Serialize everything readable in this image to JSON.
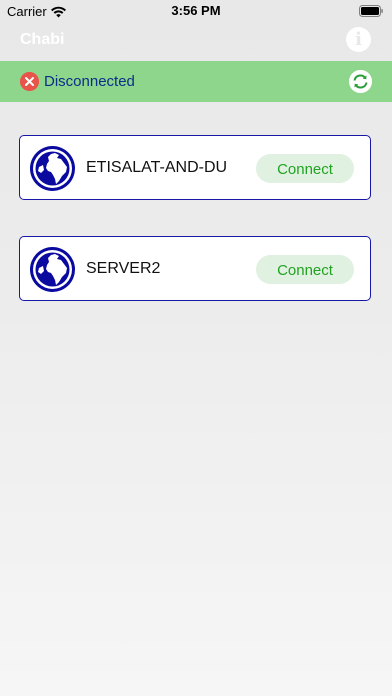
{
  "status_bar": {
    "carrier": "Carrier",
    "time": "3:56 PM"
  },
  "nav": {
    "title": "Chabi",
    "info_glyph": "i"
  },
  "banner": {
    "status_text": "Disconnected",
    "background_color": "#8ed68b",
    "text_color": "#0b2e8a",
    "status_icon": "x-circle-icon",
    "refresh_icon": "refresh-icon"
  },
  "servers": [
    {
      "name": "ETISALAT-AND-DU",
      "button_label": "Connect",
      "icon": "globe-icon"
    },
    {
      "name": "SERVER2",
      "button_label": "Connect",
      "icon": "globe-icon"
    }
  ],
  "colors": {
    "card_border": "#1818a8",
    "connect_text": "#22a222",
    "connect_bg": "#e1f1e1",
    "globe": "#0a0aa0"
  }
}
